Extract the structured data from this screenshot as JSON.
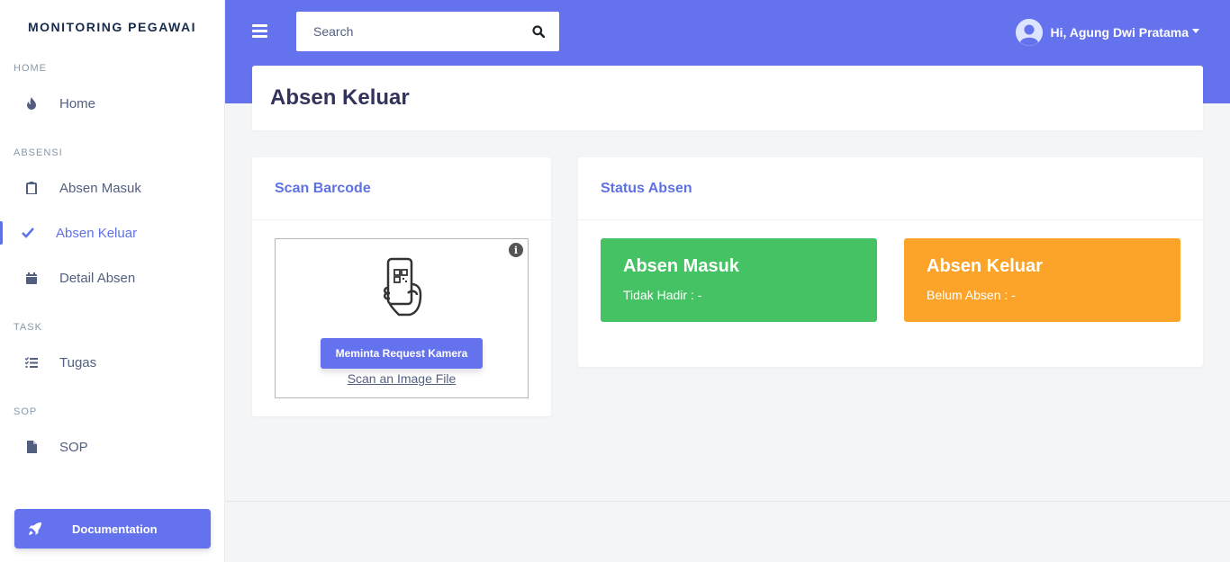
{
  "brand": "MONITORING PEGAWAI",
  "sidebar": {
    "sections": [
      {
        "heading": "HOME",
        "items": [
          {
            "label": "Home",
            "icon": "fire-icon"
          }
        ]
      },
      {
        "heading": "ABSENSI",
        "items": [
          {
            "label": "Absen Masuk",
            "icon": "clipboard-icon"
          },
          {
            "label": "Absen Keluar",
            "icon": "check-icon",
            "active": true
          },
          {
            "label": "Detail Absen",
            "icon": "calendar-icon"
          }
        ]
      },
      {
        "heading": "TASK",
        "items": [
          {
            "label": "Tugas",
            "icon": "tasks-icon"
          }
        ]
      },
      {
        "heading": "SOP",
        "items": [
          {
            "label": "SOP",
            "icon": "file-icon"
          }
        ]
      }
    ],
    "doc_button": "Documentation"
  },
  "topbar": {
    "search_placeholder": "Search",
    "user_greeting": "Hi, Agung Dwi Pratama"
  },
  "page_title": "Absen Keluar",
  "scan_card": {
    "title": "Scan Barcode",
    "request_button": "Meminta Request Kamera",
    "scan_file_link": "Scan an Image File",
    "info_glyph": "i"
  },
  "status_card": {
    "title": "Status Absen",
    "boxes": [
      {
        "title": "Absen Masuk",
        "text": "Tidak Hadir : -",
        "color": "#45c264"
      },
      {
        "title": "Absen Keluar",
        "text": "Belum Absen : -",
        "color": "#fca32a"
      }
    ]
  },
  "colors": {
    "accent": "#6472ee",
    "sidebar_bg": "#ffffff",
    "page_bg": "#f4f5f7"
  }
}
